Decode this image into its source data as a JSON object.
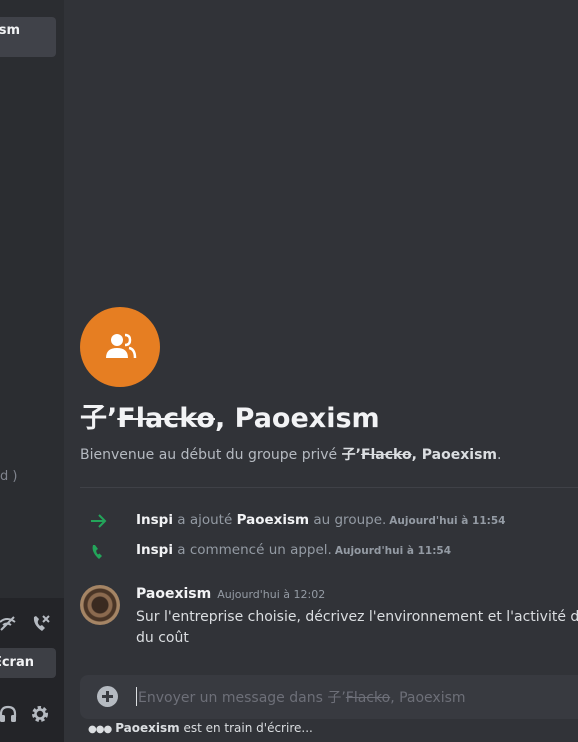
{
  "sidebar": {
    "dm_label": "sm",
    "paren_text": "d )",
    "screen_label": "Écran"
  },
  "header": {
    "title_prefix": "子’",
    "title_strike": "Flacko",
    "title_suffix": ", Paoexism",
    "welcome_pre": "Bienvenue au début du groupe privé ",
    "welcome_prefix": "子’",
    "welcome_strike": "Flacko",
    "welcome_suffix": ", Paoexism",
    "welcome_end": "."
  },
  "system": [
    {
      "icon": "arrow-right-icon",
      "color": "#23a55a",
      "actor": "Inspi",
      "action": " a ajouté ",
      "target": "Paoexism",
      "rest": " au groupe.",
      "time": "Aujourd'hui à 11:54"
    },
    {
      "icon": "phone-icon",
      "color": "#23a55a",
      "actor": "Inspi",
      "action": " a commencé un appel.",
      "time": "Aujourd'hui à 11:54"
    }
  ],
  "message": {
    "author": "Paoexism",
    "time": "Aujourd'hui à 12:02",
    "line1": "Sur l'entreprise choisie, décrivez l'environnement et l'activité de l'",
    "line2": "du coût"
  },
  "composer": {
    "placeholder_pre": "Envoyer un message dans ",
    "placeholder_prefix": "子’",
    "placeholder_strike": "Flacko",
    "placeholder_suffix": ", Paoexism"
  },
  "typing": {
    "user": "Paoexism",
    "text": " est en train d'écrire..."
  },
  "colors": {
    "accent": "#e67e22",
    "green": "#23a55a"
  }
}
